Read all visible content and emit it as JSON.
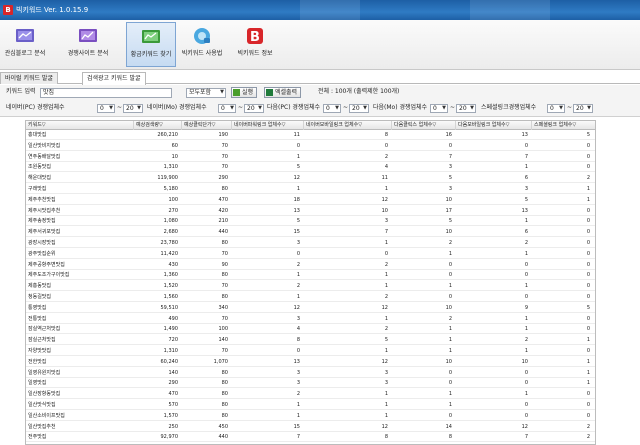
{
  "app": {
    "title": "빅키워드 Ver. 1.0.15.9",
    "colors": {
      "titlebar": "#2f7bc4",
      "accent_red": "#d8262a",
      "active_tab": "#c6dbf2"
    }
  },
  "toolbar": {
    "buttons": [
      {
        "label": "관심블로그 분석",
        "icon": "blog-analysis-icon"
      },
      {
        "label": "경쟁사이트 분석",
        "icon": "competitor-site-icon"
      },
      {
        "label": "황금키워드 찾기",
        "icon": "golden-keyword-icon",
        "active": true
      },
      {
        "label": "빅키워드 사용법",
        "icon": "usage-guide-icon"
      },
      {
        "label": "빅키워드 정보",
        "icon": "info-b-icon"
      }
    ]
  },
  "tabs": [
    "바이럴 키워드 발굴",
    "검색광고 키워드 발굴"
  ],
  "filters": {
    "keyword_label": "키워드 입력",
    "keyword_value": "맛집",
    "scope_select": "모두포함",
    "run_label": "실행",
    "excel_label": "엑셀출력",
    "total_text": "전체 : 100개 (출력제한 100개)",
    "ranges": [
      {
        "label": "네이버(PC) 경쟁업체수",
        "from": "0",
        "to": "20"
      },
      {
        "label": "네이버(Mo) 경쟁업체수",
        "from": "0",
        "to": "20"
      },
      {
        "label": "다음(PC) 경쟁업체수",
        "from": "0",
        "to": "20"
      },
      {
        "label": "다음(Mo) 경쟁업체수",
        "from": "0",
        "to": "20"
      },
      {
        "label": "스페셜링크경쟁업체수",
        "from": "0",
        "to": "20"
      }
    ]
  },
  "table": {
    "columns": [
      "키워드▽",
      "예상검색량▽",
      "예상클릭단가▽",
      "네이버파워링크 업체수▽",
      "네이버모바일링크 업체수▽",
      "다음클릭스 업체수▽",
      "다음모바일링크 업체수▽",
      "스페셜링크 업체수▽"
    ],
    "rows": [
      [
        "홍대맛집",
        "260,210",
        "190",
        "11",
        "8",
        "16",
        "13",
        "5"
      ],
      [
        "일산맛비지맛집",
        "60",
        "70",
        "0",
        "0",
        "0",
        "0",
        "0"
      ],
      [
        "연주동배달맛집",
        "10",
        "70",
        "1",
        "2",
        "7",
        "7",
        "0"
      ],
      [
        "조원동맛집",
        "1,310",
        "70",
        "5",
        "4",
        "3",
        "1",
        "0"
      ],
      [
        "해운대맛집",
        "119,900",
        "290",
        "12",
        "11",
        "5",
        "6",
        "2"
      ],
      [
        "구래맛집",
        "5,180",
        "80",
        "1",
        "1",
        "3",
        "3",
        "1"
      ],
      [
        "제주추천맛집",
        "100",
        "470",
        "18",
        "12",
        "10",
        "5",
        "1"
      ],
      [
        "제주시맛집추천",
        "270",
        "420",
        "13",
        "10",
        "17",
        "13",
        "0"
      ],
      [
        "제주송정맛집",
        "1,080",
        "210",
        "5",
        "3",
        "5",
        "1",
        "0"
      ],
      [
        "제주서귀포맛집",
        "2,680",
        "440",
        "15",
        "7",
        "10",
        "6",
        "0"
      ],
      [
        "광장시장맛집",
        "23,780",
        "80",
        "3",
        "1",
        "2",
        "2",
        "0"
      ],
      [
        "광주맛집순위",
        "11,420",
        "70",
        "0",
        "0",
        "1",
        "1",
        "0"
      ],
      [
        "제주공항주변맛집",
        "430",
        "90",
        "2",
        "2",
        "0",
        "0",
        "0"
      ],
      [
        "제주도조가구이맛집",
        "1,360",
        "80",
        "1",
        "1",
        "0",
        "0",
        "0"
      ],
      [
        "제흥동맛집",
        "1,520",
        "70",
        "2",
        "1",
        "1",
        "1",
        "0"
      ],
      [
        "청동길맛집",
        "1,560",
        "80",
        "1",
        "2",
        "0",
        "0",
        "0"
      ],
      [
        "통영맛집",
        "59,510",
        "340",
        "12",
        "12",
        "10",
        "9",
        "5"
      ],
      [
        "전통맛집",
        "490",
        "70",
        "3",
        "1",
        "2",
        "1",
        "0"
      ],
      [
        "잠실역근처맛집",
        "1,490",
        "100",
        "4",
        "2",
        "1",
        "1",
        "0"
      ],
      [
        "잠실근처맛집",
        "720",
        "140",
        "8",
        "5",
        "1",
        "2",
        "1"
      ],
      [
        "자양맛맛집",
        "1,310",
        "70",
        "0",
        "1",
        "1",
        "1",
        "0"
      ],
      [
        "전한맛집",
        "60,240",
        "1,070",
        "13",
        "12",
        "10",
        "10",
        "1"
      ],
      [
        "일영유원지맛집",
        "140",
        "80",
        "3",
        "3",
        "0",
        "0",
        "1"
      ],
      [
        "일영맛집",
        "290",
        "80",
        "3",
        "3",
        "0",
        "0",
        "1"
      ],
      [
        "일산장항동맛집",
        "470",
        "80",
        "2",
        "1",
        "1",
        "1",
        "0"
      ],
      [
        "일산맛식맛집",
        "570",
        "80",
        "1",
        "1",
        "1",
        "0",
        "0"
      ],
      [
        "일산소비이프맛집",
        "1,570",
        "80",
        "1",
        "1",
        "0",
        "0",
        "0"
      ],
      [
        "일산맛집추천",
        "250",
        "450",
        "15",
        "12",
        "14",
        "12",
        "2"
      ],
      [
        "전주맛집",
        "92,970",
        "440",
        "7",
        "8",
        "8",
        "7",
        "2"
      ]
    ]
  }
}
